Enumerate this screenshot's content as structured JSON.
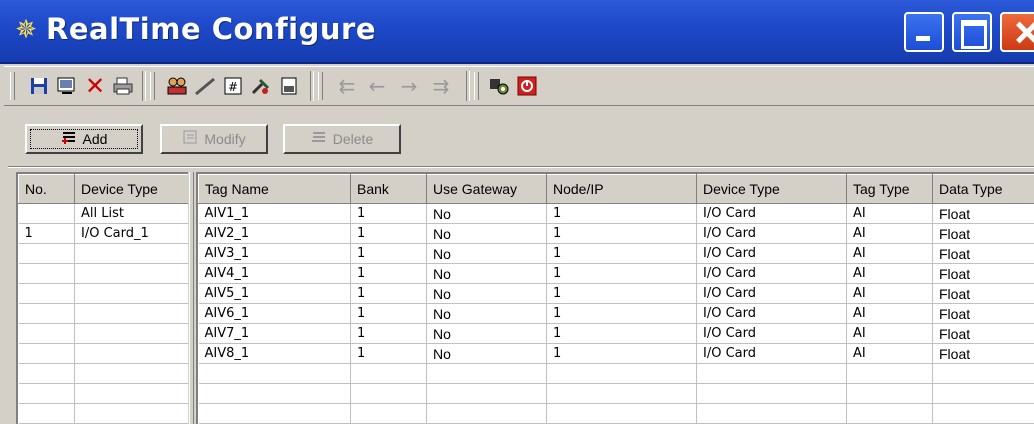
{
  "window": {
    "title": "RealTime Configure"
  },
  "toolbar": {
    "icons": [
      "save-icon",
      "screen-icon",
      "delete-x-icon",
      "print-icon",
      "users-icon",
      "line-icon",
      "tag-icon",
      "tools-icon",
      "document-icon",
      "move-first-icon",
      "move-left-icon",
      "move-right-icon",
      "move-last-icon",
      "settings-icon",
      "power-icon"
    ]
  },
  "actions": {
    "add": "Add",
    "modify": "Modify",
    "delete": "Delete"
  },
  "device_list": {
    "headers": [
      "No.",
      "Device Type"
    ],
    "rows": [
      [
        "",
        "All List"
      ],
      [
        "1",
        "I/O Card_1"
      ],
      [
        "",
        ""
      ],
      [
        "",
        ""
      ],
      [
        "",
        ""
      ],
      [
        "",
        ""
      ],
      [
        "",
        ""
      ],
      [
        "",
        ""
      ],
      [
        "",
        ""
      ],
      [
        "",
        ""
      ],
      [
        "",
        ""
      ]
    ]
  },
  "tag_list": {
    "headers": [
      "Tag Name",
      "Bank",
      "Use Gateway",
      "Node/IP",
      "Device Type",
      "Tag Type",
      "Data Type"
    ],
    "rows": [
      [
        "AIV1_1",
        "1",
        "No",
        "1",
        "I/O Card",
        "AI",
        "Float"
      ],
      [
        "AIV2_1",
        "1",
        "No",
        "1",
        "I/O Card",
        "AI",
        "Float"
      ],
      [
        "AIV3_1",
        "1",
        "No",
        "1",
        "I/O Card",
        "AI",
        "Float"
      ],
      [
        "AIV4_1",
        "1",
        "No",
        "1",
        "I/O Card",
        "AI",
        "Float"
      ],
      [
        "AIV5_1",
        "1",
        "No",
        "1",
        "I/O Card",
        "AI",
        "Float"
      ],
      [
        "AIV6_1",
        "1",
        "No",
        "1",
        "I/O Card",
        "AI",
        "Float"
      ],
      [
        "AIV7_1",
        "1",
        "No",
        "1",
        "I/O Card",
        "AI",
        "Float"
      ],
      [
        "AIV8_1",
        "1",
        "No",
        "1",
        "I/O Card",
        "AI",
        "Float"
      ],
      [
        "",
        "",
        "",
        "",
        "",
        "",
        ""
      ],
      [
        "",
        "",
        "",
        "",
        "",
        "",
        ""
      ],
      [
        "",
        "",
        "",
        "",
        "",
        "",
        ""
      ]
    ]
  }
}
